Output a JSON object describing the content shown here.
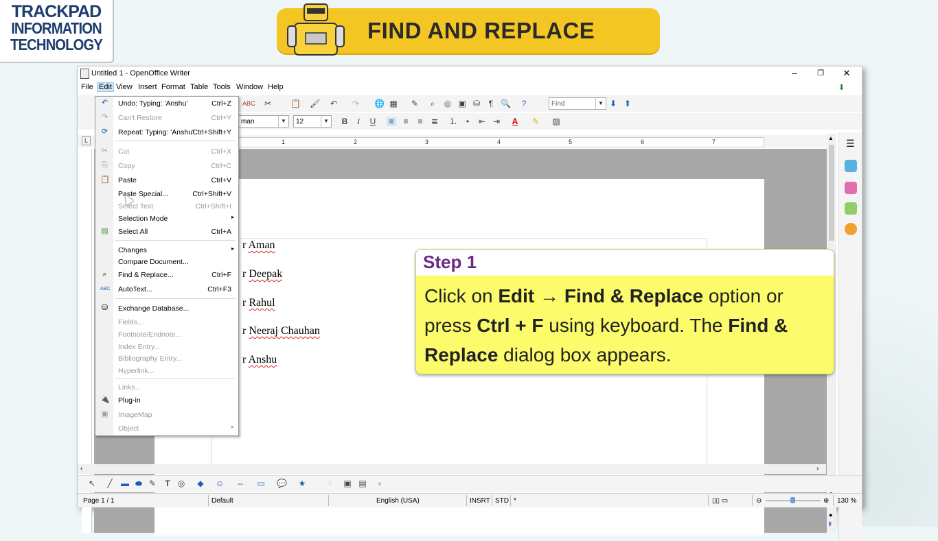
{
  "logo": {
    "line1": "TRACKPAD",
    "line2": "INFORMATION",
    "line3": "TECHNOLOGY"
  },
  "banner": {
    "title": "FIND AND REPLACE"
  },
  "window": {
    "title": "Untitled 1 - OpenOffice Writer"
  },
  "menubar": [
    "File",
    "Edit",
    "View",
    "Insert",
    "Format",
    "Table",
    "Tools",
    "Window",
    "Help"
  ],
  "toolbar": {
    "find_placeholder": "Find",
    "font_name": "man",
    "font_size": "12"
  },
  "ruler": {
    "marks": [
      "1",
      "2",
      "3",
      "4",
      "5",
      "6",
      "7"
    ]
  },
  "document": {
    "lines": [
      {
        "prefix": "r ",
        "words": "Aman"
      },
      {
        "prefix": "r ",
        "words": "Deepak"
      },
      {
        "prefix": "r ",
        "words": "Rahul"
      },
      {
        "prefix": "r ",
        "words": "Neeraj Chauhan"
      },
      {
        "prefix": "r ",
        "words": "Anshu"
      }
    ]
  },
  "edit_menu": [
    {
      "label": "Undo: Typing: 'Anshu'",
      "shortcut": "Ctrl+Z",
      "enabled": true
    },
    {
      "label": "Can't Restore",
      "shortcut": "Ctrl+Y",
      "enabled": false
    },
    {
      "label": "Repeat: Typing: 'Anshu'",
      "shortcut": "Ctrl+Shift+Y",
      "enabled": true
    },
    {
      "label": "Cut",
      "shortcut": "Ctrl+X",
      "enabled": false
    },
    {
      "label": "Copy",
      "shortcut": "Ctrl+C",
      "enabled": false
    },
    {
      "label": "Paste",
      "shortcut": "Ctrl+V",
      "enabled": true
    },
    {
      "label": "Paste Special...",
      "shortcut": "Ctrl+Shift+V",
      "enabled": true
    },
    {
      "label": "Select Text",
      "shortcut": "Ctrl+Shift+I",
      "enabled": false
    },
    {
      "label": "Selection Mode",
      "shortcut": "",
      "enabled": true,
      "submenu": true
    },
    {
      "label": "Select All",
      "shortcut": "Ctrl+A",
      "enabled": true
    },
    {
      "label": "Changes",
      "shortcut": "",
      "enabled": true,
      "submenu": true
    },
    {
      "label": "Compare Document...",
      "shortcut": "",
      "enabled": true
    },
    {
      "label": "Find & Replace...",
      "shortcut": "Ctrl+F",
      "enabled": true
    },
    {
      "label": "AutoText...",
      "shortcut": "Ctrl+F3",
      "enabled": true
    },
    {
      "label": "Exchange Database...",
      "shortcut": "",
      "enabled": true
    },
    {
      "label": "Fields...",
      "shortcut": "",
      "enabled": false
    },
    {
      "label": "Footnote/Endnote...",
      "shortcut": "",
      "enabled": false
    },
    {
      "label": "Index Entry...",
      "shortcut": "",
      "enabled": false
    },
    {
      "label": "Bibliography Entry...",
      "shortcut": "",
      "enabled": false
    },
    {
      "label": "Hyperlink...",
      "shortcut": "",
      "enabled": false
    },
    {
      "label": "Links...",
      "shortcut": "",
      "enabled": false
    },
    {
      "label": "Plug-in",
      "shortcut": "",
      "enabled": true
    },
    {
      "label": "ImageMap",
      "shortcut": "",
      "enabled": false
    },
    {
      "label": "Object",
      "shortcut": "",
      "enabled": false,
      "submenu": true
    }
  ],
  "callout": {
    "heading": "Step 1",
    "t1": "Click on ",
    "b1": "Edit",
    "t2": " → ",
    "b2": "Find & Replace",
    "t3": " option or press ",
    "b3": "Ctrl + F",
    "t4": " using keyboard. The ",
    "b4": "Find & Replace",
    "t5": " dialog box appears."
  },
  "statusbar": {
    "page": "Page 1 / 1",
    "style": "Default",
    "language": "English (USA)",
    "mode": "INSRT",
    "sel": "STD",
    "modified": "*",
    "zoom": "130 %"
  }
}
